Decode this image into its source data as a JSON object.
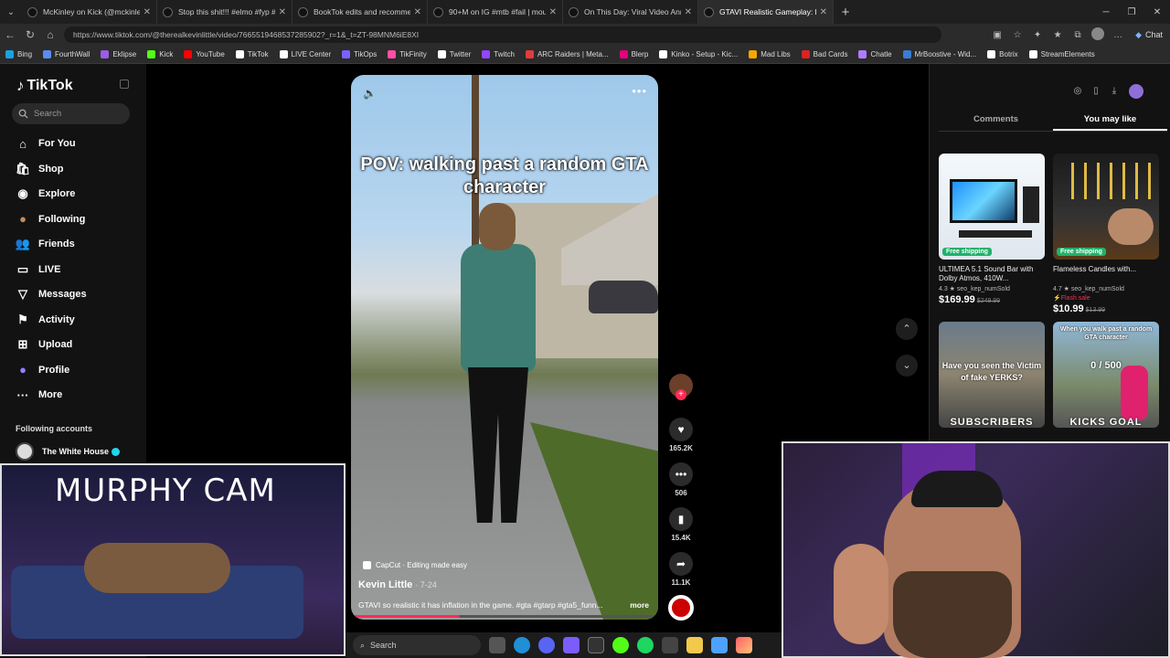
{
  "browser": {
    "tabs": [
      {
        "title": "McKinley on Kick (@mckinley.tv) |",
        "active": false
      },
      {
        "title": "Stop this shit!!! #elmo #fyp #parod",
        "active": false
      },
      {
        "title": "BookTok edits and recommendati",
        "active": false
      },
      {
        "title": "90+M on IG #mtb #fail | mountai",
        "active": false
      },
      {
        "title": "On This Day: Viral Video Annivers",
        "active": false
      },
      {
        "title": "GTAVI Realistic Gameplay: Infl",
        "active": true
      }
    ],
    "url": "https://www.tiktok.com/@therealkevinlittle/video/7665519468537285902?_r=1&_t=ZT-98MNM6iE8XI",
    "chat_label": "Chat",
    "bookmarks": [
      {
        "label": "Bing",
        "color": "#1ba1e2"
      },
      {
        "label": "FourthWall",
        "color": "#5a8dee"
      },
      {
        "label": "Eklipse",
        "color": "#9b5de5"
      },
      {
        "label": "Kick",
        "color": "#53fc18"
      },
      {
        "label": "YouTube",
        "color": "#ff0000"
      },
      {
        "label": "TikTok",
        "color": "#ffffff"
      },
      {
        "label": "LIVE Center",
        "color": "#ffffff"
      },
      {
        "label": "TikOps",
        "color": "#7b61ff"
      },
      {
        "label": "TikFinity",
        "color": "#ff4fa3"
      },
      {
        "label": "Twitter",
        "color": "#ffffff"
      },
      {
        "label": "Twitch",
        "color": "#9146ff"
      },
      {
        "label": "ARC Raiders | Meta...",
        "color": "#e23b3b"
      },
      {
        "label": "Blerp",
        "color": "#e4007c"
      },
      {
        "label": "Kinko - Setup - Kic...",
        "color": "#ffffff"
      },
      {
        "label": "Mad Libs",
        "color": "#f7a600"
      },
      {
        "label": "Bad Cards",
        "color": "#d22"
      },
      {
        "label": "Chatle",
        "color": "#b07cff"
      },
      {
        "label": "MrBoostive - Wid...",
        "color": "#3a7bd5"
      },
      {
        "label": "Botrix",
        "color": "#ffffff"
      },
      {
        "label": "StreamElements",
        "color": "#ffffff"
      }
    ]
  },
  "sidebar": {
    "logo": "TikTok",
    "search_placeholder": "Search",
    "items": [
      {
        "label": "For You",
        "icon": "home-icon"
      },
      {
        "label": "Shop",
        "icon": "shop-icon"
      },
      {
        "label": "Explore",
        "icon": "compass-icon"
      },
      {
        "label": "Following",
        "icon": "avatar-icon"
      },
      {
        "label": "Friends",
        "icon": "friends-icon"
      },
      {
        "label": "LIVE",
        "icon": "live-icon"
      },
      {
        "label": "Messages",
        "icon": "messages-icon"
      },
      {
        "label": "Activity",
        "icon": "activity-icon"
      },
      {
        "label": "Upload",
        "icon": "upload-icon"
      },
      {
        "label": "Profile",
        "icon": "profile-icon"
      },
      {
        "label": "More",
        "icon": "more-icon"
      }
    ],
    "following_heading": "Following accounts",
    "following": [
      {
        "name": "The White House"
      }
    ]
  },
  "overlay_cam": {
    "title": "MURPHY CAM"
  },
  "video": {
    "caption": "POV: walking past a random GTA character",
    "capcut": "CapCut · Editing made easy",
    "author": "Kevin Little",
    "date": "· 7-24",
    "description": "GTAVI so realistic it has inflation in the game. #gta #gtarp #gta5_funn...",
    "more_label": "more",
    "progress": 0.35,
    "likes": "165.2K",
    "comments": "506",
    "saves": "15.4K",
    "shares": "11.1K"
  },
  "right_panel": {
    "tabs": [
      "Comments",
      "You may like"
    ],
    "active_tab": "You may like",
    "products": [
      {
        "title": "ULTIMEA 5.1 Sound Bar with Dolby Atmos, 410W...",
        "badge": "Free shipping",
        "rating": "4.3 ★",
        "sold": "seo_kep_numSold",
        "price": "$169.99",
        "old_price": "$249.99",
        "flash": ""
      },
      {
        "title": "Flameless Candles with...",
        "badge": "Free shipping",
        "rating": "4.7 ★",
        "sold": "seo_kep_numSold",
        "price": "$10.99",
        "old_price": "$13.99",
        "flash": "Flash sale"
      }
    ],
    "videos": [
      {
        "text": "Have you seen the Victim of fake YERKS?",
        "bottom": "SUBSCRIBERS"
      },
      {
        "text": "When you walk past a random GTA character",
        "count": "0 / 500",
        "bottom": "KICKS GOAL"
      }
    ]
  },
  "taskbar": {
    "search_label": "Search"
  }
}
